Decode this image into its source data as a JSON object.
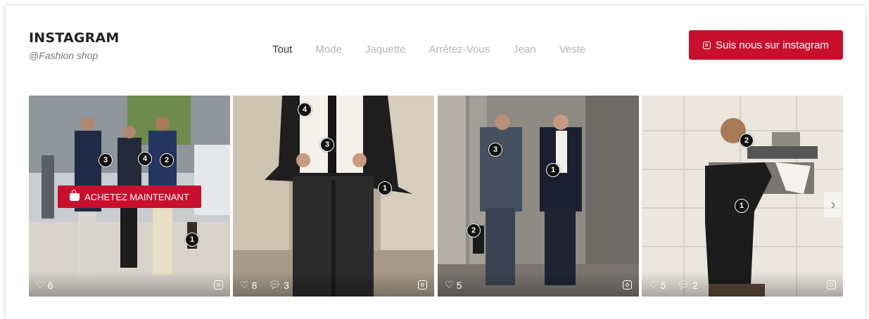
{
  "header": {
    "title": "INSTAGRAM",
    "subtitle": "@Fashion shop",
    "follow_label": "Suis nous sur instagram"
  },
  "filters": [
    "Tout",
    "Mode",
    "Jaquette",
    "Arrêtez-Vous",
    "Jean",
    "Veste"
  ],
  "active_filter": "Tout",
  "posts": [
    {
      "likes": "6",
      "comments": "",
      "tags": [
        "3",
        "4",
        "2",
        "1"
      ],
      "shop_label": "ACHETEZ MAINTENANT"
    },
    {
      "likes": "8",
      "comments": "3",
      "tags": [
        "4",
        "3",
        "1"
      ]
    },
    {
      "likes": "5",
      "comments": "",
      "tags": [
        "3",
        "1",
        "2"
      ]
    },
    {
      "likes": "5",
      "comments": "2",
      "tags": [
        "2",
        "1"
      ]
    }
  ],
  "colors": {
    "accent": "#c8102e",
    "active_filter": "#333333",
    "inactive_filter": "#b4b4b4"
  },
  "icons": {
    "follow": "instagram-icon",
    "post_corner": "instagram-icon",
    "likes": "heart-icon",
    "comments": "comment-icon",
    "shop": "shopping-basket-icon",
    "next": "chevron-right-icon"
  }
}
